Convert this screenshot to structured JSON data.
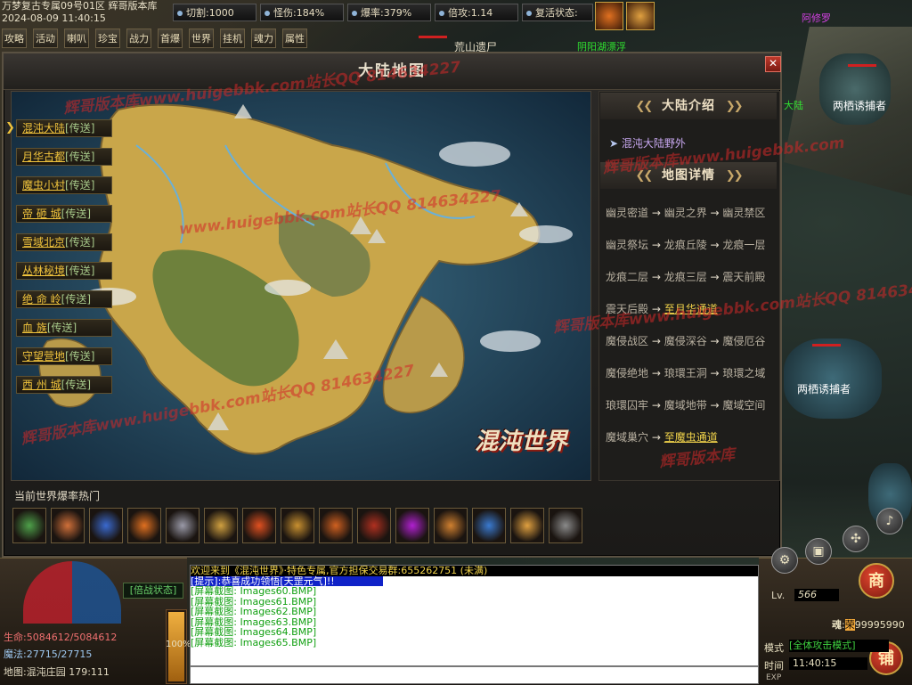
{
  "server": {
    "line1": "万梦复古专属09号01区 辉哥版本库",
    "line2": "2024-08-09 11:40:15"
  },
  "stats": [
    {
      "label": "切割:1000"
    },
    {
      "label": "怪伤:184%"
    },
    {
      "label": "爆率:379%"
    },
    {
      "label": "倍攻:1.14"
    },
    {
      "label": "复活状态:"
    }
  ],
  "top_buttons": [
    "攻略",
    "活动",
    "喇叭",
    "珍宝",
    "战力",
    "首爆",
    "世界",
    "挂机",
    "魂力",
    "属性"
  ],
  "scene": {
    "npc_top": "荒山遗尸",
    "npc_top2": "阴阳湖漂浮",
    "npc_top3": "阿修罗",
    "npc_right1": "两栖诱捕者",
    "npc_right2": "两栖诱捕者",
    "npc_side": "大陆"
  },
  "dialog": {
    "title": "大陆地图",
    "locations": [
      {
        "name": "混沌大陆",
        "tp": "[传送]"
      },
      {
        "name": "月华古都",
        "tp": "[传送]"
      },
      {
        "name": "魔虫小村",
        "tp": "[传送]"
      },
      {
        "name": "帝 砸 城",
        "tp": "[传送]"
      },
      {
        "name": "雪域北京",
        "tp": "[传送]"
      },
      {
        "name": "丛林秘境",
        "tp": "[传送]"
      },
      {
        "name": "绝 命 岭",
        "tp": "[传送]"
      },
      {
        "name": "血  族",
        "tp": "[传送]"
      },
      {
        "name": "守望营地",
        "tp": "[传送]"
      },
      {
        "name": "西 州 城",
        "tp": "[传送]"
      }
    ],
    "map_logo": "混沌世界",
    "intro_title": "大陆介绍",
    "intro_item": "混沌大陆野外",
    "detail_title": "地图详情",
    "routes": [
      {
        "parts": [
          "幽灵密道",
          "幽灵之界",
          "幽灵禁区"
        ],
        "hl": false
      },
      {
        "parts": [
          "幽灵祭坛",
          "龙痕丘陵",
          "龙痕一层"
        ],
        "hl": false
      },
      {
        "parts": [
          "龙痕二层",
          "龙痕三层",
          "震天前殿"
        ],
        "hl": false
      },
      {
        "parts": [
          "震天后殿",
          "至月华通道"
        ],
        "hl": true
      },
      {
        "parts": [
          "魔侵战区",
          "魔侵深谷",
          "魔侵厄谷"
        ],
        "hl": false
      },
      {
        "parts": [
          "魔侵绝地",
          "琅環王洞",
          "琅環之域"
        ],
        "hl": false
      },
      {
        "parts": [
          "琅環囚牢",
          "魔域地带",
          "魔域空间"
        ],
        "hl": false
      },
      {
        "parts": [
          "魔域巢穴",
          "至魔虫通道"
        ],
        "hl": true
      }
    ],
    "hot_label": "当前世界爆率热门",
    "hot_items": [
      {
        "icon": "green-sword-icon",
        "color": "#4ea04a"
      },
      {
        "icon": "scroll-icon",
        "color": "#d0703a"
      },
      {
        "icon": "blue-armor-icon",
        "color": "#3a6ad0"
      },
      {
        "icon": "fire-rune-icon",
        "color": "#e07020"
      },
      {
        "icon": "dark-helmet-icon",
        "color": "#9a9aa8"
      },
      {
        "icon": "gold-gauntlet-icon",
        "color": "#d0a040"
      },
      {
        "icon": "flame-blade-icon",
        "color": "#e05020"
      },
      {
        "icon": "gold-ring-icon",
        "color": "#c89030"
      },
      {
        "icon": "boots-icon",
        "color": "#d06020"
      },
      {
        "icon": "red-book-icon",
        "color": "#b03020"
      },
      {
        "icon": "purple-orb-icon",
        "color": "#b020d0"
      },
      {
        "icon": "amulet-icon",
        "color": "#d08030"
      },
      {
        "icon": "blue-ring-icon",
        "color": "#3a7ad0"
      },
      {
        "icon": "lantern-icon",
        "color": "#e0a040"
      },
      {
        "icon": "beast-icon",
        "color": "#8a8a8a"
      }
    ]
  },
  "hud": {
    "hp": "生命:5084612/5084612",
    "mp": "魔法:27715/27715",
    "location": "地图:混沌庄园 179:111",
    "battle": "[倍战状态]",
    "exp_pct": "100%",
    "exp_fill": 1.0,
    "chat": {
      "line1": "欢迎来到《混沌世界》·特色专属,官方担保交易群:655262751 (未满)",
      "line2": "[提示]:恭喜成功领悟[天罡元气]!!",
      "sys": [
        "[屏幕截图: Images60.BMP]",
        "[屏幕截图: Images61.BMP]",
        "[屏幕截图: Images62.BMP]",
        "[屏幕截图: Images63.BMP]",
        "[屏幕截图: Images64.BMP]",
        "[屏幕截图: Images65.BMP]"
      ]
    },
    "level_label": "Lv.",
    "level": "566",
    "soul_label": "魂",
    "soul_value": "荣",
    "soul_num": "99995990",
    "mode_label": "模式",
    "mode": "[全体攻击模式]",
    "time_label": "时间",
    "time": "11:40:15",
    "exp_label": "EXP",
    "shop_btn": "商",
    "store_btn": "铺"
  },
  "watermarks": [
    "辉哥版本库www.huigebbk.com站长QQ 814634227",
    "www.huigebbk.com站长QQ 814634227",
    "辉哥版本库www.huigebbk.com站长QQ 814634227",
    "辉哥版本库www.huigebbk.com",
    "辉哥版本库www.huigebbk.com站长QQ 814634227",
    "辉哥版本库"
  ]
}
